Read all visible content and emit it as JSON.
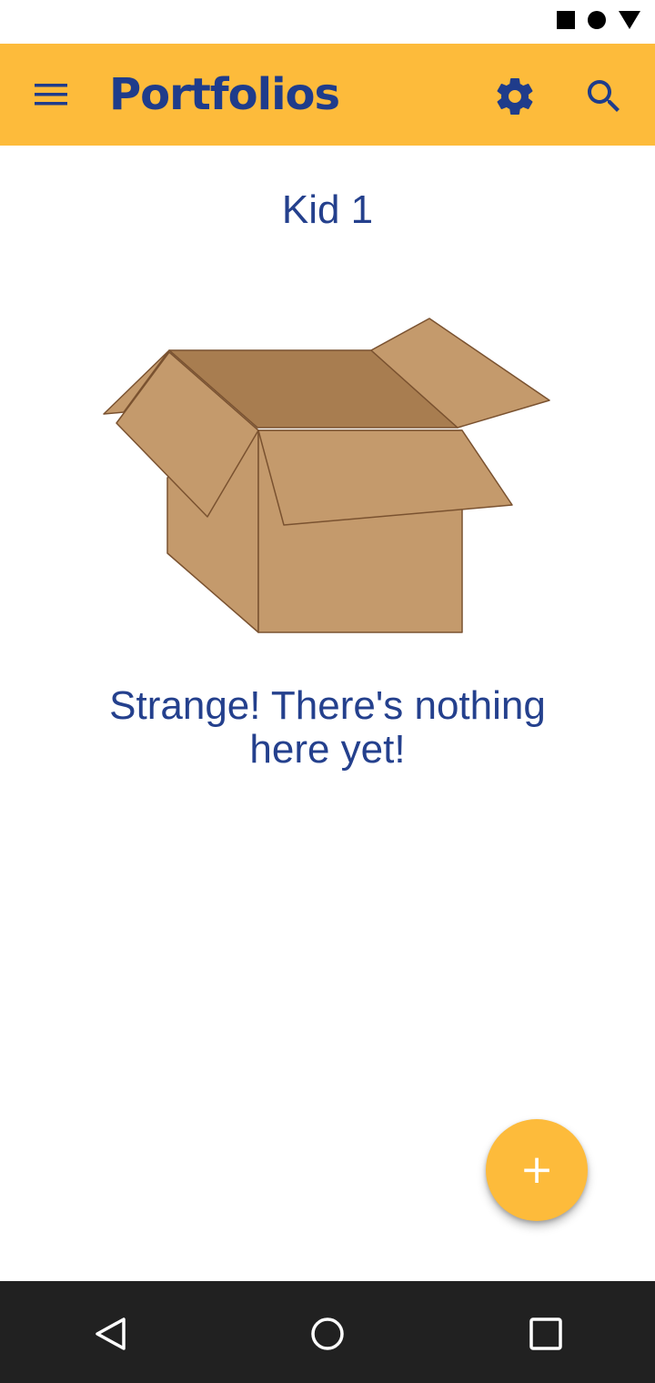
{
  "app_bar": {
    "title": "Portfolios",
    "background_color": "#fdbb3b",
    "title_color": "#1f3c8b",
    "icons": [
      "menu-icon",
      "settings-icon",
      "search-icon"
    ]
  },
  "content": {
    "kid_name": "Kid 1",
    "illustration": "open-cardboard-box",
    "empty_message": "Strange! There's nothing here yet!",
    "text_color": "#24408d"
  },
  "fab": {
    "label": "+",
    "color": "#fdbb3b"
  },
  "status_bar": {
    "icons": [
      "square-icon",
      "circle-icon",
      "triangle-icon"
    ]
  },
  "navigation_bar": {
    "icons": [
      "back-icon",
      "home-icon",
      "recents-icon"
    ],
    "background_color": "#212121"
  }
}
